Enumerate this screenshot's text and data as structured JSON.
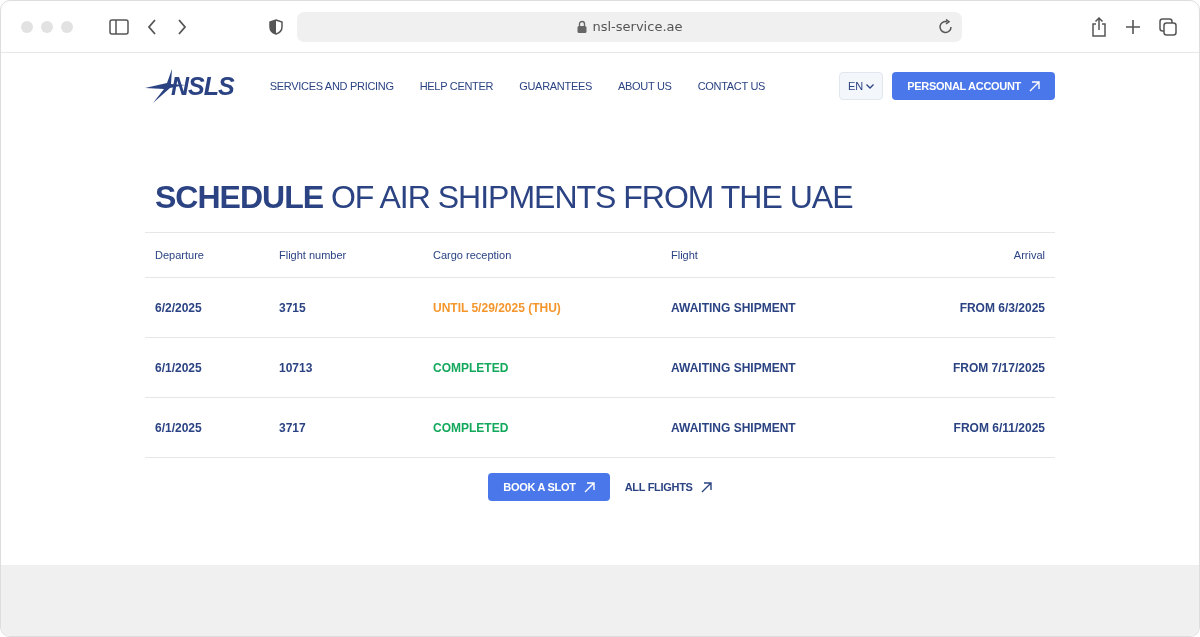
{
  "browser": {
    "url": "nsl-service.ae"
  },
  "header": {
    "logo": "NSLS",
    "nav": [
      "SERVICES AND PRICING",
      "HELP CENTER",
      "GUARANTEES",
      "ABOUT US",
      "CONTACT US"
    ],
    "language": "EN",
    "account_button": "PERSONAL ACCOUNT"
  },
  "title": {
    "bold": "SCHEDULE",
    "rest": "OF AIR SHIPMENTS FROM THE UAE"
  },
  "table": {
    "columns": [
      "Departure",
      "Flight number",
      "Cargo reception",
      "Flight",
      "Arrival"
    ],
    "rows": [
      {
        "departure": "6/2/2025",
        "flight_number": "3715",
        "cargo_reception": {
          "kind": "pending",
          "text": "UNTIL 5/29/2025 (THU)"
        },
        "flight": "AWAITING SHIPMENT",
        "arrival": "FROM 6/3/2025"
      },
      {
        "departure": "6/1/2025",
        "flight_number": "10713",
        "cargo_reception": {
          "kind": "completed",
          "text": "COMPLETED"
        },
        "flight": "AWAITING SHIPMENT",
        "arrival": "FROM 7/17/2025"
      },
      {
        "departure": "6/1/2025",
        "flight_number": "3717",
        "cargo_reception": {
          "kind": "completed",
          "text": "COMPLETED"
        },
        "flight": "AWAITING SHIPMENT",
        "arrival": "FROM 6/11/2025"
      }
    ]
  },
  "actions": {
    "book_button": "BOOK A SLOT",
    "all_flights_link": "ALL FLIGHTS"
  }
}
